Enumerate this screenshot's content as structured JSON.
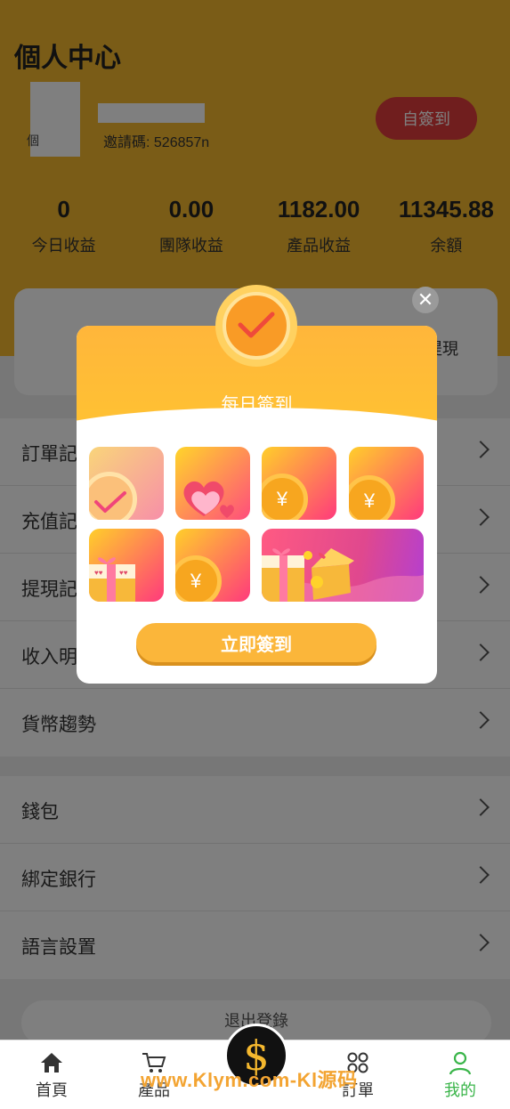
{
  "header": {
    "title": "個人中心",
    "avatar_glyph": "個",
    "invite_text": "邀請碼: 526857n",
    "checkin_label": "自簽到"
  },
  "stats": [
    {
      "value": "0",
      "label": "今日收益"
    },
    {
      "value": "0.00",
      "label": "團隊收益"
    },
    {
      "value": "1182.00",
      "label": "產品收益"
    },
    {
      "value": "11345.88",
      "label": "余額"
    }
  ],
  "card": {
    "label": "提現"
  },
  "menu_group_1": [
    {
      "label": "訂單記"
    },
    {
      "label": "充值記"
    },
    {
      "label": "提現記"
    },
    {
      "label": "收入明"
    },
    {
      "label": "貨幣趨勢"
    }
  ],
  "menu_group_2": [
    {
      "label": "錢包"
    },
    {
      "label": "綁定銀行"
    },
    {
      "label": "語言設置"
    }
  ],
  "logout_label": "退出登錄",
  "tabbar": [
    {
      "label": "首頁",
      "icon": "home-icon"
    },
    {
      "label": "產品",
      "icon": "cart-icon"
    },
    {
      "label": "訂單",
      "icon": "grid-icon"
    },
    {
      "label": "我的",
      "icon": "user-icon"
    }
  ],
  "center_symbol": "$",
  "watermark": "www.Klym.com-Kl源码",
  "modal": {
    "title": "每日簽到",
    "button_label": "立即簽到",
    "close_symbol": "✕",
    "coin_symbol": "¥"
  },
  "colors": {
    "header_bg": "#f5b82e",
    "accent_red": "#e03c3c",
    "active_tab": "#3ab54a",
    "modal_orange": "#fbb63a"
  }
}
